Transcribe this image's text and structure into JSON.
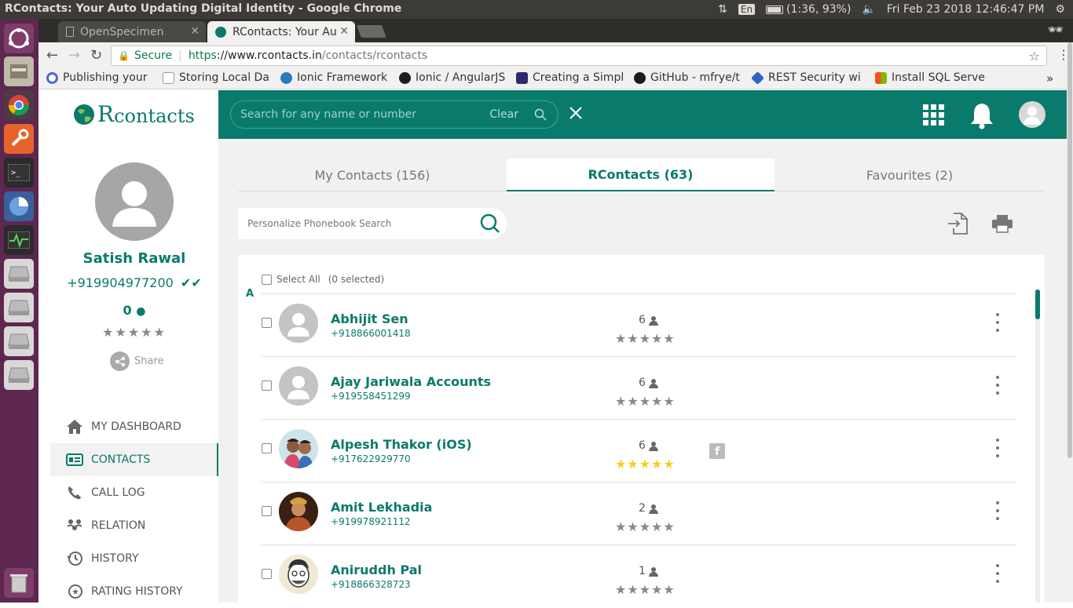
{
  "os": {
    "window_title": "RContacts: Your Auto Updating Digital Identity - Google Chrome",
    "keyboard": "En",
    "battery": "(1:36, 93%)",
    "clock": "Fri Feb 23 2018 12:46:47 PM"
  },
  "browser": {
    "tabs": [
      {
        "label": "OpenSpecimen"
      },
      {
        "label": "RContacts: Your Au"
      }
    ],
    "secure_label": "Secure",
    "url_scheme": "https",
    "url_host": "://www.rcontacts.in",
    "url_path": "/contacts/rcontacts",
    "bookmarks": [
      {
        "label": "Publishing your",
        "color": "#4a6cd4"
      },
      {
        "label": "Storing Local Da",
        "color": "#ffffff"
      },
      {
        "label": "Ionic Framework",
        "color": "#2a7ac0"
      },
      {
        "label": "Ionic / AngularJS",
        "color": "#1b1b1b"
      },
      {
        "label": "Creating a Simpl",
        "color": "#2d2b6e"
      },
      {
        "label": "GitHub - mfrye/t",
        "color": "#1b1b1b"
      },
      {
        "label": "REST Security wi",
        "color": "#3060c8"
      },
      {
        "label": "Install SQL Serve",
        "color": "#e04a2a"
      }
    ],
    "more_bookmarks": "»"
  },
  "app": {
    "logo_r": "R",
    "logo_text": "contacts",
    "search_placeholder": "Search for any name or number",
    "search_clear": "Clear",
    "accent": "#0a7a6c",
    "user": {
      "name": "Satish Rawal",
      "phone": "+919904977200",
      "connections": "0",
      "stars": "★★★★★",
      "share_label": "Share"
    },
    "nav": [
      {
        "label": "MY DASHBOARD",
        "icon": "home-icon"
      },
      {
        "label": "CONTACTS",
        "icon": "contact-card-icon"
      },
      {
        "label": "CALL LOG",
        "icon": "phone-icon"
      },
      {
        "label": "RELATION",
        "icon": "relation-icon"
      },
      {
        "label": "HISTORY",
        "icon": "history-icon"
      },
      {
        "label": "RATING HISTORY",
        "icon": "rating-history-icon"
      }
    ],
    "tabs": [
      {
        "label": "My Contacts (156)"
      },
      {
        "label": "RContacts (63)"
      },
      {
        "label": "Favourites (2)"
      }
    ],
    "phonebook_placeholder": "Personalize Phonebook Search",
    "select_all": "Select All",
    "selected_count": "(0 selected)",
    "group_letter": "A",
    "contacts": [
      {
        "name": "Abhijit Sen",
        "phone": "+918866001418",
        "count": "6",
        "stars": "★★★★★",
        "rated": false,
        "photo": "none"
      },
      {
        "name": "Ajay Jariwala Accounts",
        "phone": "+919558451299",
        "count": "6",
        "stars": "★★★★★",
        "rated": false,
        "photo": "none"
      },
      {
        "name": "Alpesh Thakor (iOS)",
        "phone": "+917622929770",
        "count": "6",
        "stars": "★★★★★",
        "rated": true,
        "photo": "couple"
      },
      {
        "name": "Amit Lekhadia",
        "phone": "+919978921112",
        "count": "2",
        "stars": "★★★★★",
        "rated": false,
        "photo": "dark"
      },
      {
        "name": "Aniruddh Pal",
        "phone": "+918866328723",
        "count": "1",
        "stars": "★★★★★",
        "rated": false,
        "photo": "cartoon"
      }
    ]
  }
}
